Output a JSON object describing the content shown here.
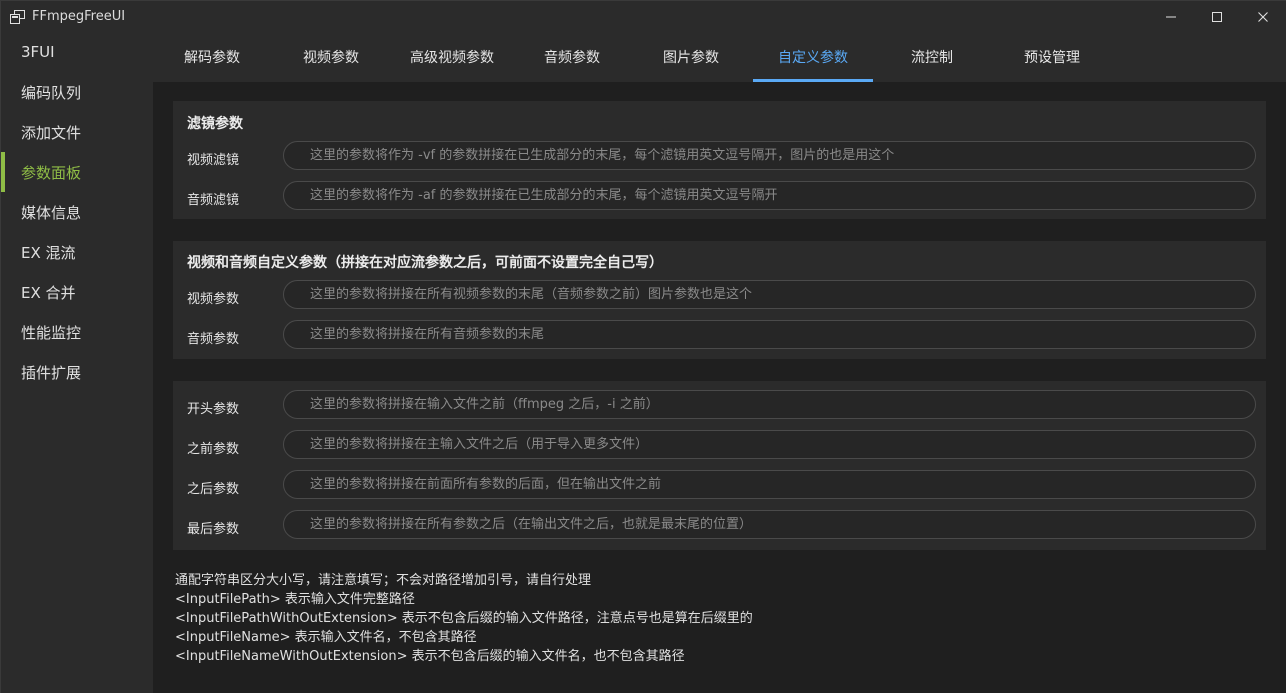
{
  "window": {
    "title": "FFmpegFreeUI",
    "icon": "app-window-icon"
  },
  "sidebar": {
    "items": [
      {
        "label": "3FUI"
      },
      {
        "label": "编码队列"
      },
      {
        "label": "添加文件"
      },
      {
        "label": "参数面板",
        "active": true
      },
      {
        "label": "媒体信息"
      },
      {
        "label": "EX 混流"
      },
      {
        "label": "EX 合并"
      },
      {
        "label": "性能监控"
      },
      {
        "label": "插件扩展"
      }
    ]
  },
  "tabs": [
    {
      "label": "解码参数"
    },
    {
      "label": "视频参数"
    },
    {
      "label": "高级视频参数"
    },
    {
      "label": "音频参数"
    },
    {
      "label": "图片参数"
    },
    {
      "label": "自定义参数",
      "active": true
    },
    {
      "label": "流控制"
    },
    {
      "label": "预设管理"
    }
  ],
  "filters": {
    "title": "滤镜参数",
    "video_label": "视频滤镜",
    "video_placeholder": "这里的参数将作为 -vf 的参数拼接在已生成部分的末尾，每个滤镜用英文逗号隔开，图片的也是用这个",
    "video_value": "",
    "audio_label": "音频滤镜",
    "audio_placeholder": "这里的参数将作为 -af 的参数拼接在已生成部分的末尾，每个滤镜用英文逗号隔开",
    "audio_value": ""
  },
  "custom_av": {
    "title": "视频和音频自定义参数（拼接在对应流参数之后，可前面不设置完全自己写）",
    "video_label": "视频参数",
    "video_placeholder": "这里的参数将拼接在所有视频参数的末尾（音频参数之前）图片参数也是这个",
    "video_value": "",
    "audio_label": "音频参数",
    "audio_placeholder": "这里的参数将拼接在所有音频参数的末尾",
    "audio_value": ""
  },
  "position_params": {
    "start_label": "开头参数",
    "start_placeholder": "这里的参数将拼接在输入文件之前（ffmpeg 之后，-i 之前）",
    "start_value": "",
    "before_label": "之前参数",
    "before_placeholder": "这里的参数将拼接在主输入文件之后（用于导入更多文件）",
    "before_value": "",
    "after_label": "之后参数",
    "after_placeholder": "这里的参数将拼接在前面所有参数的后面，但在输出文件之前",
    "after_value": "",
    "last_label": "最后参数",
    "last_placeholder": "这里的参数将拼接在所有参数之后（在输出文件之后，也就是最末尾的位置）",
    "last_value": ""
  },
  "notes": [
    "通配字符串区分大小写，请注意填写；不会对路径增加引号，请自行处理",
    "<InputFilePath> 表示输入文件完整路径",
    "<InputFilePathWithOutExtension> 表示不包含后缀的输入文件路径，注意点号也是算在后缀里的",
    "<InputFileName> 表示输入文件名，不包含其路径",
    "<InputFileNameWithOutExtension> 表示不包含后缀的输入文件名，也不包含其路径"
  ],
  "colors": {
    "accent_green": "#8fbd46",
    "accent_blue": "#5aa9f5",
    "background": "#1f1f1f",
    "panel": "#2b2b2b"
  }
}
